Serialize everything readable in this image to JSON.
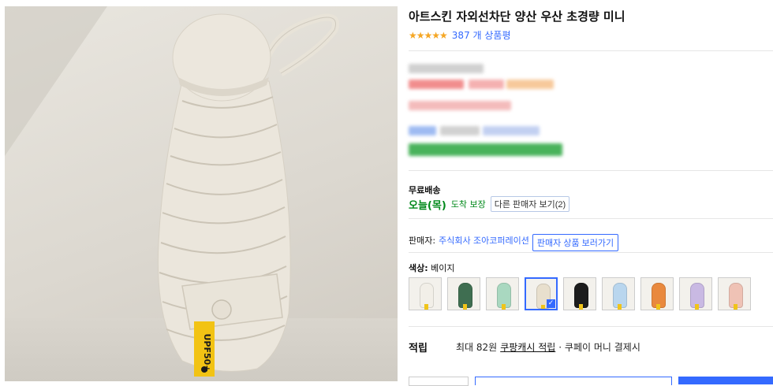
{
  "product": {
    "title": "아트스킨 자외선차단 양산 우산 초경량 미니",
    "stars": "★★★★★",
    "review_count": "387 개 상품평",
    "rating": 4.5
  },
  "shipping": {
    "free_label": "무료배송",
    "arrival_day": "오늘(목)",
    "arrival_guarantee": "도착 보장",
    "other_sellers_button": "다른 판매자 보기(2)"
  },
  "seller": {
    "label": "판매자:",
    "name": "주식회사 조아코퍼레이션",
    "store_button": "판매자 상품 보러가기"
  },
  "color": {
    "label": "색상:",
    "selected": "베이지",
    "options": [
      {
        "color": "#f2efe8"
      },
      {
        "color": "#3f6e51"
      },
      {
        "color": "#a9d8c0"
      },
      {
        "color": "#e8dfcd"
      },
      {
        "color": "#1c1c1c"
      },
      {
        "color": "#b9d6ee"
      },
      {
        "color": "#e9893e"
      },
      {
        "color": "#c9b9e3"
      },
      {
        "color": "#efc2b5"
      }
    ],
    "selected_index": 3
  },
  "reward": {
    "title": "적립",
    "prefix": "최대 82원",
    "link": "쿠팡캐시 적립",
    "suffix": "· 쿠페이 머니 결제시"
  },
  "colors": {
    "accent": "#346aff",
    "green": "#00891a",
    "star": "#f5a623"
  }
}
